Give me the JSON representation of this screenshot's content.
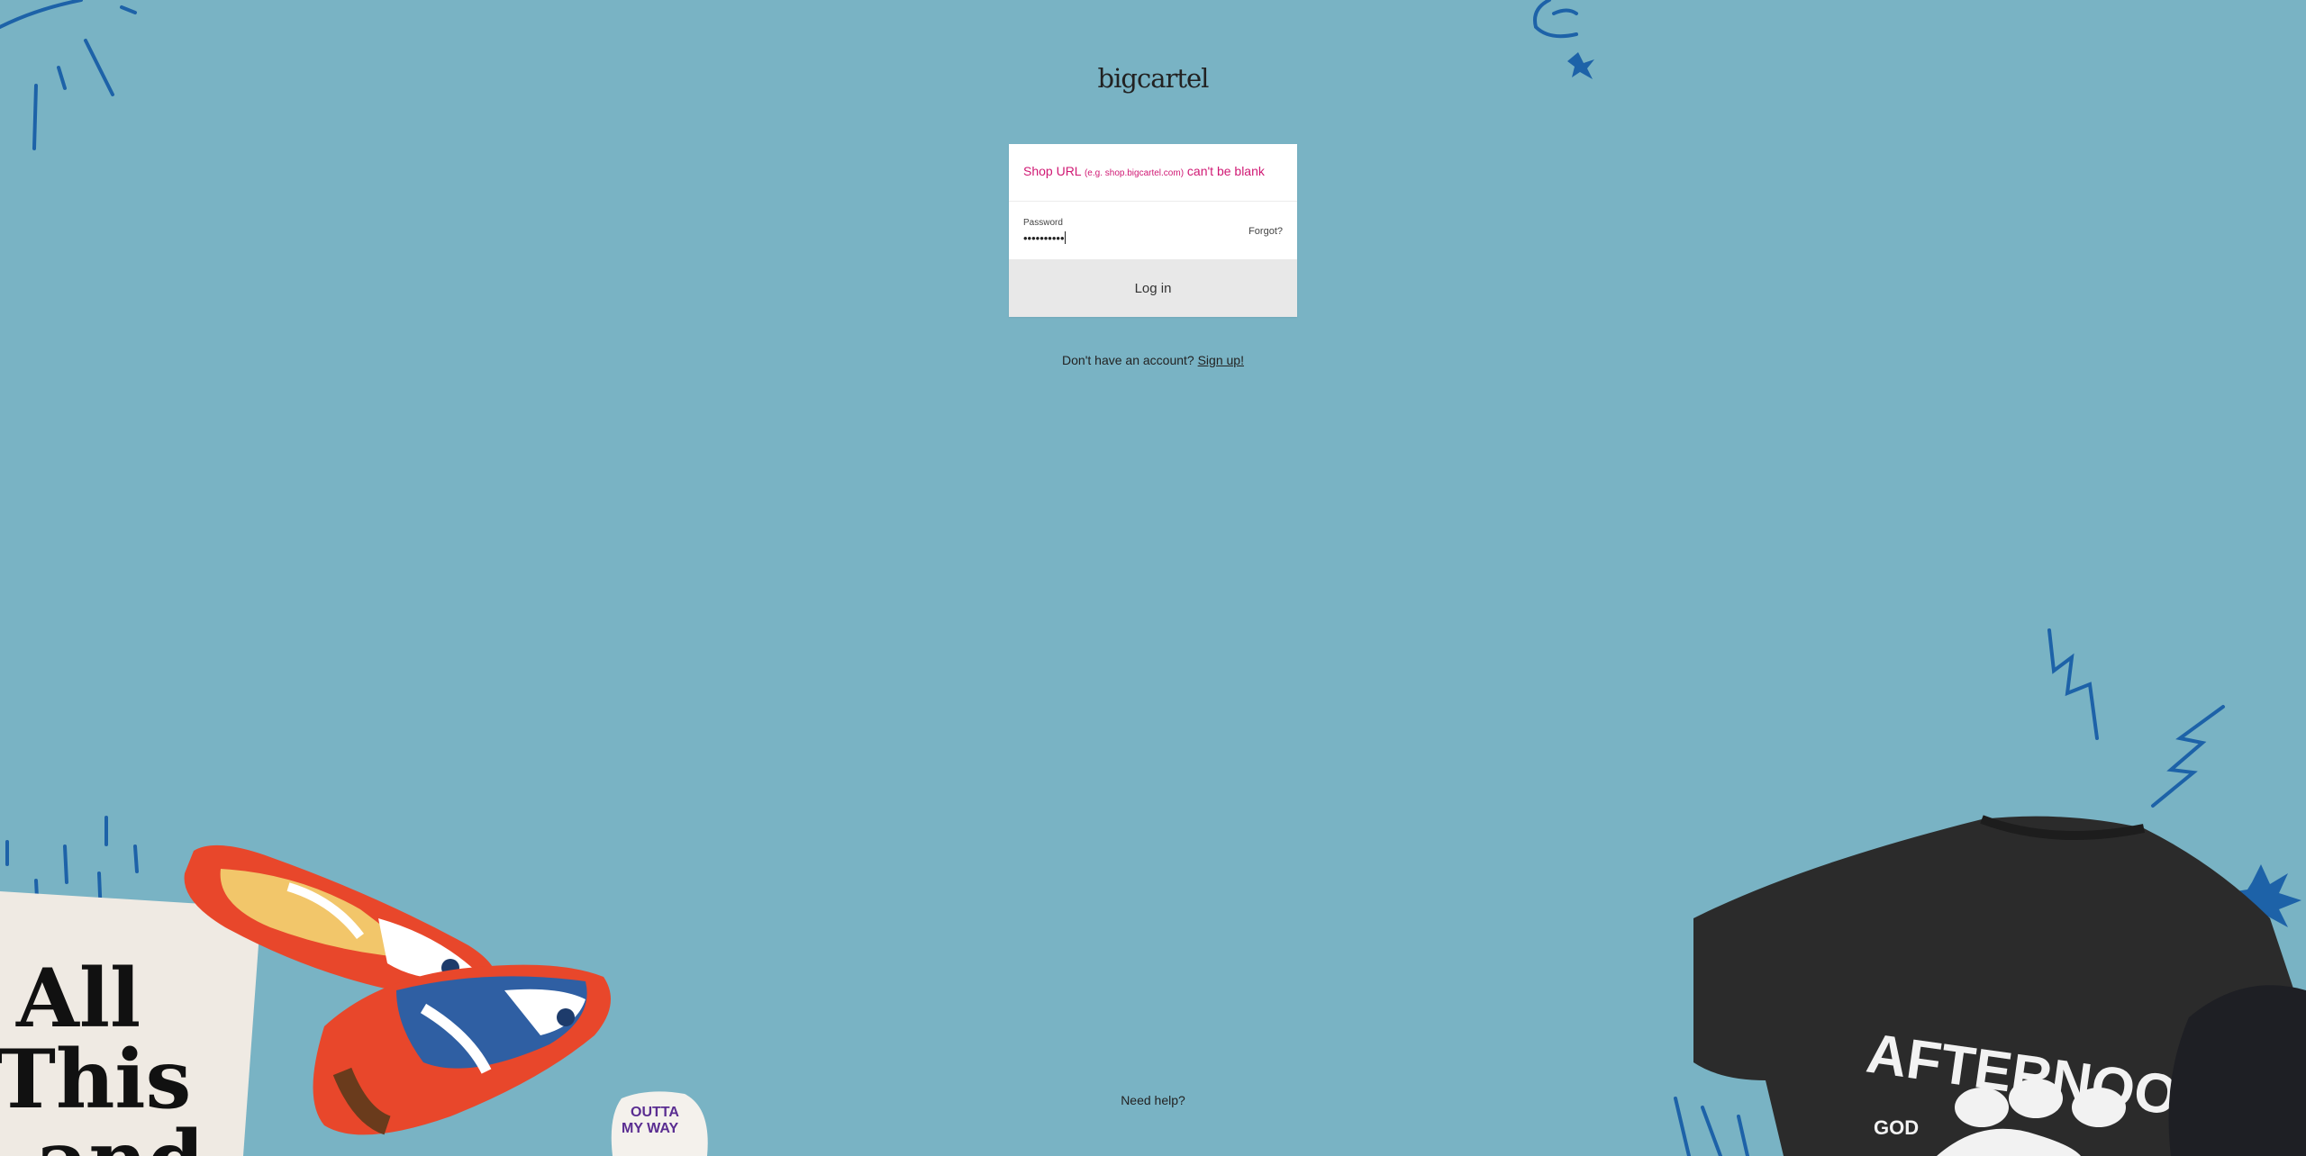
{
  "brand": {
    "logo_text": "bigcartel"
  },
  "login_form": {
    "shop_error": {
      "label": "Shop URL",
      "example": "(e.g. shop.bigcartel.com)",
      "message": "can't be blank"
    },
    "password": {
      "label": "Password",
      "masked_value": "••••••••••"
    },
    "forgot_label": "Forgot?",
    "login_button_label": "Log in"
  },
  "signup": {
    "prompt": "Don't have an account?",
    "link_label": "Sign up!"
  },
  "footer": {
    "help_label": "Need help?"
  },
  "artwork": {
    "poster_lines": [
      "All",
      "This",
      "and"
    ],
    "sticker_lines": [
      "OUTTA",
      "MY WAY"
    ],
    "tshirt_lines": [
      "AFTERNOON",
      "GOD"
    ]
  },
  "colors": {
    "background": "#79b3c4",
    "error": "#d01974",
    "button_bg": "#e8e8e8",
    "doodle": "#1d62a8"
  }
}
